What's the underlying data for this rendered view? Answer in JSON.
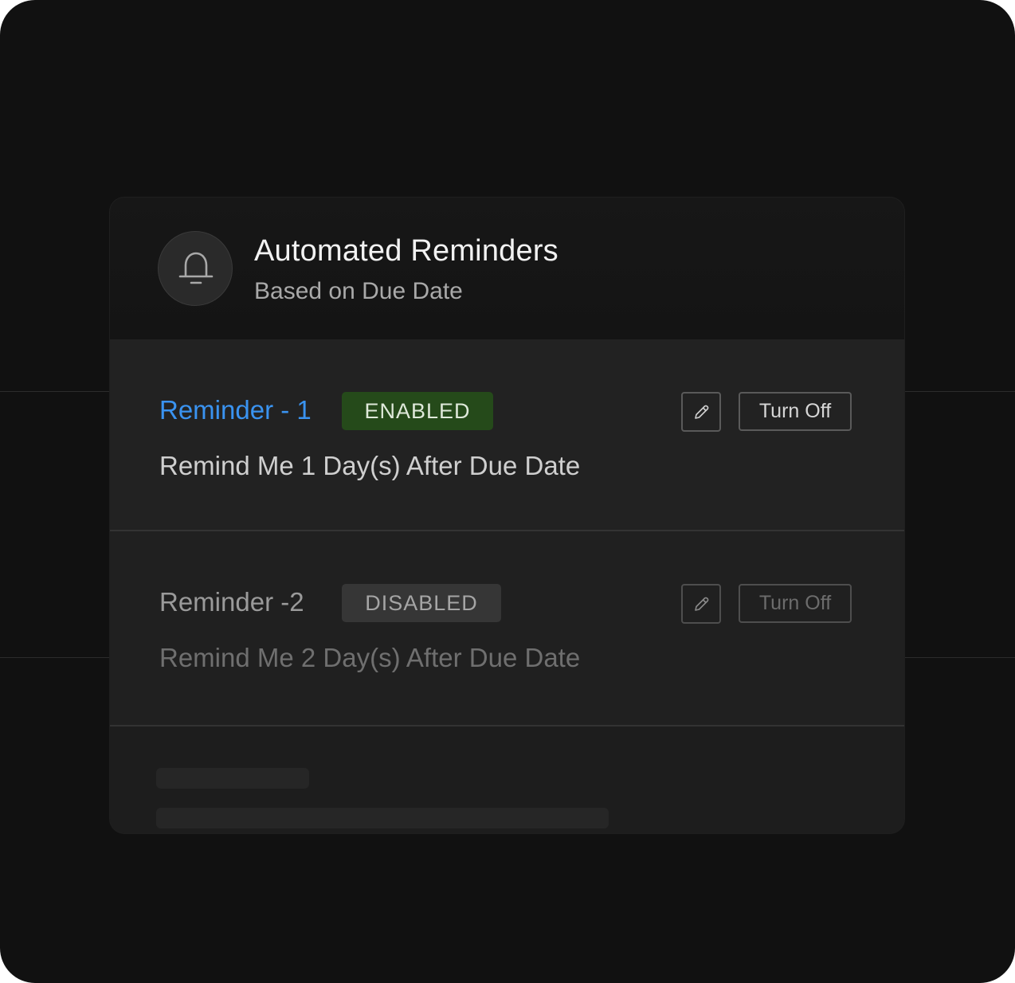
{
  "card": {
    "title": "Automated Reminders",
    "subtitle": "Based on Due Date",
    "icon": "bell-icon"
  },
  "reminders": [
    {
      "name": "Reminder - 1",
      "status": "ENABLED",
      "description": "Remind Me 1 Day(s) After Due Date",
      "action_label": "Turn Off",
      "edit_icon": "pencil-icon",
      "name_color": "#3a93f0",
      "status_color": "#254a1a"
    },
    {
      "name": "Reminder -2",
      "status": "DISABLED",
      "description": "Remind Me 2 Day(s) After Due Date",
      "action_label": "Turn Off",
      "edit_icon": "pencil-icon",
      "name_color": "#9a9a9a",
      "status_color": "#363636"
    }
  ],
  "colors": {
    "background": "#111111",
    "card": "#1d1d1d",
    "accent": "#3a93f0",
    "enabled_badge": "#254a1a"
  }
}
